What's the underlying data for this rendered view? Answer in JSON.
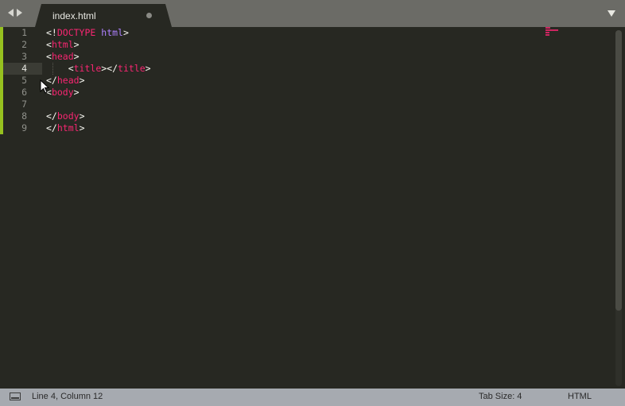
{
  "tab": {
    "filename": "index.html"
  },
  "editor": {
    "current_line": 4,
    "lines": [
      {
        "num": "1",
        "tokens": [
          {
            "t": "<!",
            "c": "punc"
          },
          {
            "t": "DOCTYPE",
            "c": "tag"
          },
          {
            "t": " ",
            "c": "punc"
          },
          {
            "t": "html",
            "c": "attr"
          },
          {
            "t": ">",
            "c": "punc"
          }
        ]
      },
      {
        "num": "2",
        "tokens": [
          {
            "t": "<",
            "c": "punc"
          },
          {
            "t": "html",
            "c": "tag"
          },
          {
            "t": ">",
            "c": "punc"
          }
        ]
      },
      {
        "num": "3",
        "tokens": [
          {
            "t": "<",
            "c": "punc"
          },
          {
            "t": "head",
            "c": "tag"
          },
          {
            "t": ">",
            "c": "punc"
          }
        ]
      },
      {
        "num": "4",
        "tokens": [
          {
            "t": "    <",
            "c": "punc"
          },
          {
            "t": "title",
            "c": "tag"
          },
          {
            "t": "></",
            "c": "punc"
          },
          {
            "t": "title",
            "c": "tag"
          },
          {
            "t": ">",
            "c": "punc"
          }
        ]
      },
      {
        "num": "5",
        "tokens": [
          {
            "t": "</",
            "c": "punc"
          },
          {
            "t": "head",
            "c": "tag"
          },
          {
            "t": ">",
            "c": "punc"
          }
        ]
      },
      {
        "num": "6",
        "tokens": [
          {
            "t": "<",
            "c": "punc"
          },
          {
            "t": "body",
            "c": "tag"
          },
          {
            "t": ">",
            "c": "punc"
          }
        ]
      },
      {
        "num": "7",
        "tokens": []
      },
      {
        "num": "8",
        "tokens": [
          {
            "t": "</",
            "c": "punc"
          },
          {
            "t": "body",
            "c": "tag"
          },
          {
            "t": ">",
            "c": "punc"
          }
        ]
      },
      {
        "num": "9",
        "tokens": [
          {
            "t": "</",
            "c": "punc"
          },
          {
            "t": "html",
            "c": "tag"
          },
          {
            "t": ">",
            "c": "punc"
          }
        ]
      }
    ]
  },
  "statusbar": {
    "position": "Line 4, Column 12",
    "tab_size": "Tab Size: 4",
    "syntax": "HTML"
  },
  "colors": {
    "background": "#272822",
    "tag": "#f92672",
    "attr": "#ae81ff",
    "modified_gutter": "#96c11f"
  }
}
